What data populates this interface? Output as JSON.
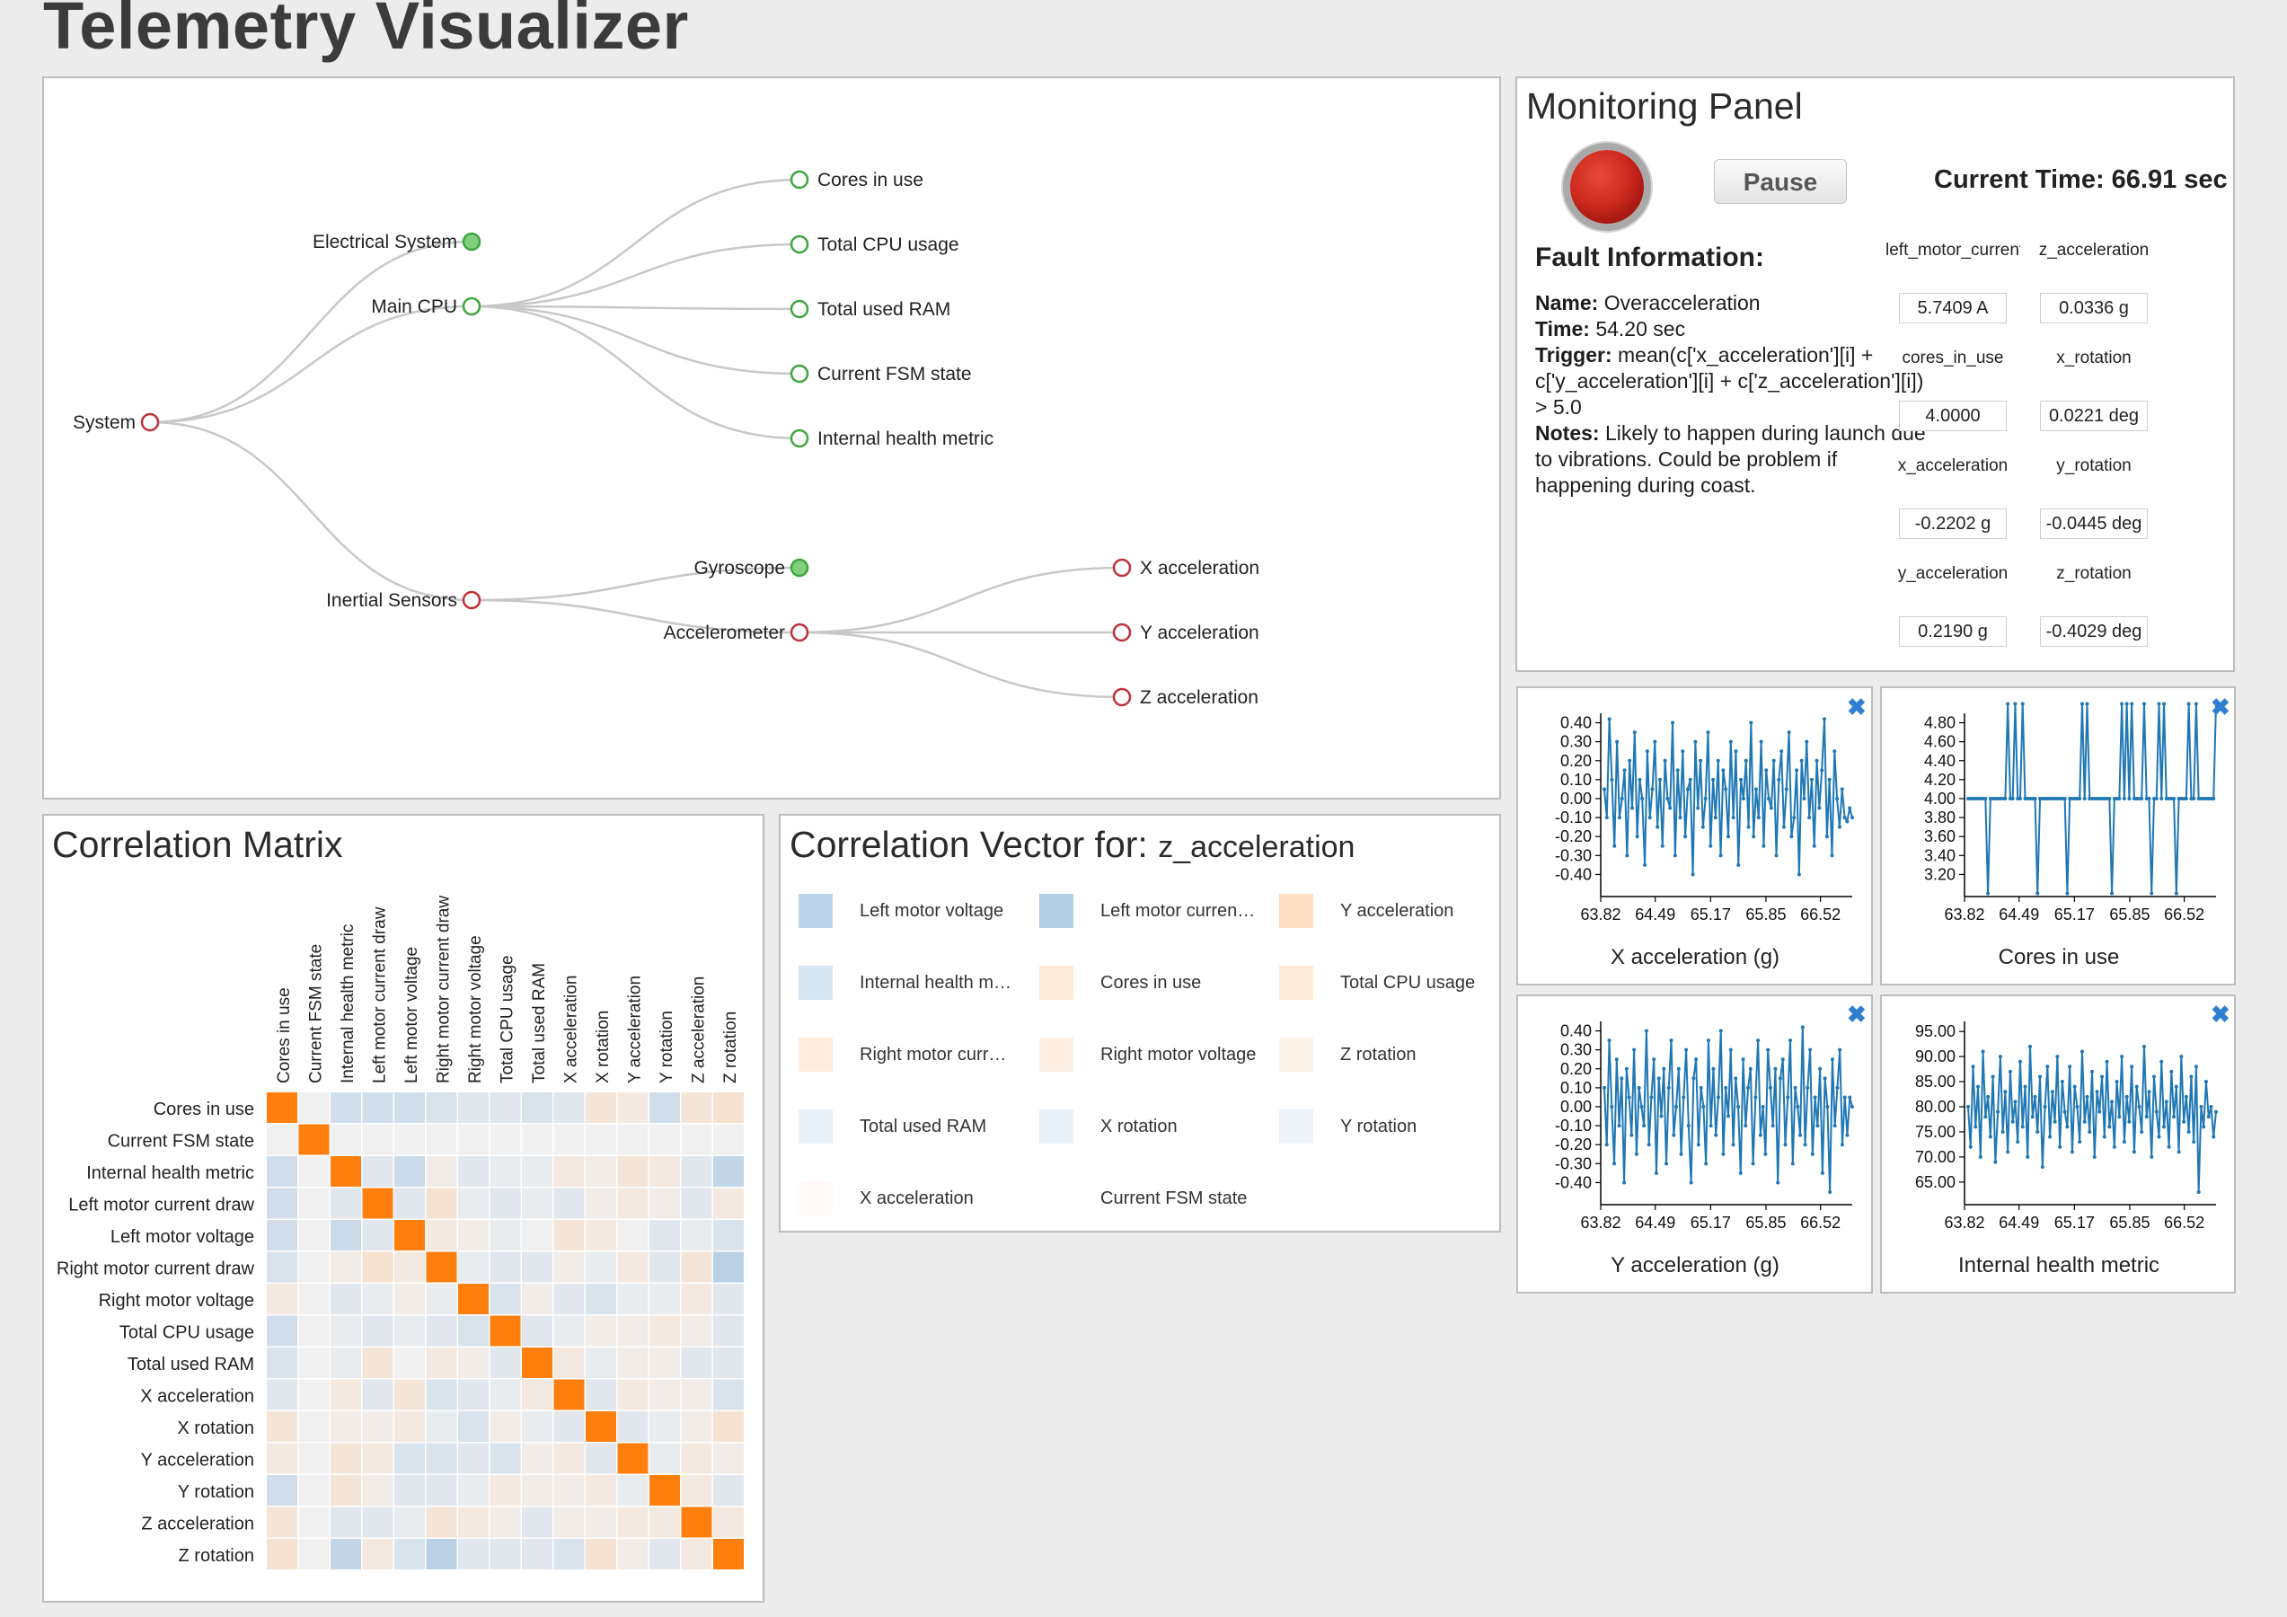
{
  "app": {
    "title": "Telemetry Visualizer"
  },
  "tree": {
    "nodes": [
      {
        "id": "system",
        "label": "System",
        "filled": false,
        "color": "#c0303a"
      },
      {
        "id": "electrical",
        "label": "Electrical System",
        "filled": true,
        "color": "#3fa53f"
      },
      {
        "id": "main_cpu",
        "label": "Main CPU",
        "filled": false,
        "color": "#3fa53f"
      },
      {
        "id": "inertial",
        "label": "Inertial Sensors",
        "filled": false,
        "color": "#c0303a"
      },
      {
        "id": "cores",
        "label": "Cores in use",
        "filled": false,
        "color": "#3fa53f"
      },
      {
        "id": "cpu_usage",
        "label": "Total CPU usage",
        "filled": false,
        "color": "#3fa53f"
      },
      {
        "id": "ram",
        "label": "Total used RAM",
        "filled": false,
        "color": "#3fa53f"
      },
      {
        "id": "fsm",
        "label": "Current FSM state",
        "filled": false,
        "color": "#3fa53f"
      },
      {
        "id": "health",
        "label": "Internal health metric",
        "filled": false,
        "color": "#3fa53f"
      },
      {
        "id": "gyro",
        "label": "Gyroscope",
        "filled": true,
        "color": "#3fa53f"
      },
      {
        "id": "accel",
        "label": "Accelerometer",
        "filled": false,
        "color": "#c0303a"
      },
      {
        "id": "xacc",
        "label": "X acceleration",
        "filled": false,
        "color": "#c0303a"
      },
      {
        "id": "yacc",
        "label": "Y acceleration",
        "filled": false,
        "color": "#c0303a"
      },
      {
        "id": "zacc",
        "label": "Z acceleration",
        "filled": false,
        "color": "#c0303a"
      }
    ],
    "edges": [
      [
        "system",
        "electrical"
      ],
      [
        "system",
        "main_cpu"
      ],
      [
        "system",
        "inertial"
      ],
      [
        "main_cpu",
        "cores"
      ],
      [
        "main_cpu",
        "cpu_usage"
      ],
      [
        "main_cpu",
        "ram"
      ],
      [
        "main_cpu",
        "fsm"
      ],
      [
        "main_cpu",
        "health"
      ],
      [
        "inertial",
        "gyro"
      ],
      [
        "inertial",
        "accel"
      ],
      [
        "accel",
        "xacc"
      ],
      [
        "accel",
        "yacc"
      ],
      [
        "accel",
        "zacc"
      ]
    ]
  },
  "monitoring": {
    "title": "Monitoring Panel",
    "pause_label": "Pause",
    "current_time_label": "Current Time: 66.91 sec",
    "fault_heading": "Fault Information:",
    "fault": {
      "name_label": "Name:",
      "name": "Overacceleration",
      "time_label": "Time:",
      "time": "54.20 sec",
      "trigger_label": "Trigger:",
      "trigger": "mean(c['x_acceleration'][i] + c['y_acceleration'][i] + c['z_acceleration'][i]) > 5.0",
      "notes_label": "Notes:",
      "notes": "Likely to happen during launch due to vibrations. Could be problem if happening during coast."
    },
    "values": [
      {
        "name": "left_motor_current",
        "value": "5.7409 A"
      },
      {
        "name": "z_acceleration",
        "value": "0.0336 g"
      },
      {
        "name": "cores_in_use",
        "value": "4.0000"
      },
      {
        "name": "x_rotation",
        "value": "0.0221 deg"
      },
      {
        "name": "x_acceleration",
        "value": "-0.2202 g"
      },
      {
        "name": "y_rotation",
        "value": "-0.0445 deg"
      },
      {
        "name": "y_acceleration",
        "value": "0.2190 g"
      },
      {
        "name": "z_rotation",
        "value": "-0.4029 deg"
      }
    ]
  },
  "correlation_matrix": {
    "title": "Correlation Matrix",
    "labels": [
      "Cores in use",
      "Current FSM state",
      "Internal health metric",
      "Left motor current draw",
      "Left motor voltage",
      "Right motor current draw",
      "Right motor voltage",
      "Total CPU usage",
      "Total used RAM",
      "X acceleration",
      "X rotation",
      "Y acceleration",
      "Y rotation",
      "Z acceleration",
      "Z rotation"
    ],
    "colors": {
      "positive": "#ff7f0e",
      "negative": "#1f77b4",
      "neutral": "#f0f0f0"
    },
    "values": [
      [
        1,
        0,
        -0.2,
        -0.2,
        -0.2,
        -0.15,
        -0.1,
        -0.1,
        -0.15,
        -0.1,
        0.15,
        0.1,
        -0.2,
        0.15,
        0.2
      ],
      [
        0,
        1,
        0,
        0,
        0,
        0,
        0,
        0,
        0,
        0,
        0,
        0,
        0,
        0,
        0
      ],
      [
        -0.2,
        0,
        1,
        -0.1,
        -0.25,
        0.05,
        -0.1,
        -0.05,
        -0.05,
        0.1,
        0.05,
        0.15,
        0.1,
        -0.1,
        -0.3
      ],
      [
        -0.2,
        0,
        -0.1,
        1,
        -0.1,
        0.2,
        -0.05,
        -0.1,
        -0.05,
        -0.1,
        0.05,
        0.1,
        0.05,
        -0.1,
        0.1
      ],
      [
        -0.2,
        0,
        -0.25,
        -0.1,
        1,
        0.1,
        0.05,
        -0.05,
        0,
        0.15,
        0.1,
        0,
        -0.1,
        -0.05,
        -0.15
      ],
      [
        -0.15,
        0,
        0.05,
        0.2,
        0.1,
        1,
        -0.05,
        -0.1,
        -0.1,
        0.05,
        -0.05,
        0.1,
        -0.1,
        0.15,
        -0.35
      ],
      [
        0.1,
        0,
        -0.1,
        -0.05,
        0.05,
        -0.05,
        1,
        -0.15,
        0.05,
        -0.1,
        -0.15,
        -0.05,
        -0.05,
        0.1,
        -0.1
      ],
      [
        -0.2,
        0,
        -0.05,
        -0.1,
        -0.05,
        -0.1,
        -0.15,
        1,
        -0.1,
        -0.05,
        0.05,
        0.05,
        0.1,
        0.05,
        -0.1
      ],
      [
        -0.15,
        0,
        -0.05,
        0.15,
        0,
        0.1,
        0.05,
        -0.1,
        1,
        0.1,
        -0.05,
        0.05,
        0.05,
        -0.1,
        -0.1
      ],
      [
        -0.1,
        0,
        0.1,
        -0.1,
        0.15,
        -0.15,
        -0.1,
        -0.05,
        0.1,
        1,
        -0.1,
        0.1,
        0.05,
        0.05,
        -0.15
      ],
      [
        0.15,
        0,
        0.05,
        0.05,
        0.1,
        -0.05,
        -0.15,
        0.05,
        -0.05,
        -0.1,
        1,
        -0.1,
        -0.05,
        0.05,
        0.2
      ],
      [
        0.1,
        0,
        0.15,
        0.1,
        -0.15,
        -0.15,
        -0.1,
        -0.15,
        0.05,
        0.1,
        -0.1,
        1,
        -0.05,
        0.1,
        0.05
      ],
      [
        -0.2,
        0,
        0.15,
        0.05,
        -0.1,
        -0.1,
        -0.05,
        0.1,
        0.05,
        0.05,
        0.1,
        -0.05,
        1,
        0.1,
        -0.1
      ],
      [
        0.15,
        0,
        -0.1,
        -0.1,
        -0.05,
        0.15,
        0.1,
        0.05,
        -0.1,
        0.05,
        0.05,
        0.1,
        0.1,
        1,
        0.1
      ],
      [
        0.2,
        0,
        -0.3,
        0.1,
        -0.15,
        -0.35,
        -0.1,
        -0.1,
        -0.1,
        -0.15,
        0.2,
        0.05,
        -0.1,
        0.1,
        1
      ]
    ]
  },
  "correlation_vector": {
    "title_prefix": "Correlation Vector for:",
    "variable": "z_acceleration",
    "items": [
      {
        "label": "Left motor voltage",
        "value": -0.25
      },
      {
        "label": "Left motor curren…",
        "value": -0.28
      },
      {
        "label": "Y acceleration",
        "value": 0.22
      },
      {
        "label": "Internal health m…",
        "value": -0.15
      },
      {
        "label": "Cores in use",
        "value": 0.14
      },
      {
        "label": "Total CPU usage",
        "value": 0.14
      },
      {
        "label": "Right motor curr…",
        "value": 0.12
      },
      {
        "label": "Right motor voltage",
        "value": 0.1
      },
      {
        "label": "Z rotation",
        "value": 0.08
      },
      {
        "label": "Total used RAM",
        "value": -0.08
      },
      {
        "label": "X rotation",
        "value": -0.08
      },
      {
        "label": "Y rotation",
        "value": -0.07
      },
      {
        "label": "X acceleration",
        "value": 0.03
      },
      {
        "label": "Current FSM state",
        "value": 0
      }
    ]
  },
  "chart_data": [
    {
      "type": "line",
      "title": "X acceleration (g)",
      "color": "#1f77b4",
      "xlim": [
        63.82,
        66.91
      ],
      "ylim": [
        -0.45,
        0.45
      ],
      "xticks": [
        "63.82",
        "64.49",
        "65.17",
        "65.85",
        "66.52"
      ],
      "yticks": [
        "0.40",
        "0.30",
        "0.20",
        "0.10",
        "0.00",
        "-0.10",
        "-0.20",
        "-0.30",
        "-0.40"
      ],
      "values": [
        0.05,
        -0.1,
        0.42,
        0.1,
        -0.25,
        0.3,
        -0.1,
        0.0,
        0.15,
        -0.3,
        0.2,
        -0.05,
        0.35,
        -0.2,
        0.1,
        0.0,
        -0.35,
        0.25,
        -0.1,
        0.05,
        0.3,
        -0.15,
        0.1,
        -0.25,
        0.2,
        0.0,
        -0.05,
        0.4,
        -0.3,
        0.15,
        -0.1,
        0.25,
        -0.2,
        0.05,
        0.1,
        -0.4,
        0.3,
        -0.05,
        0.2,
        -0.15,
        0.0,
        0.35,
        -0.25,
        0.1,
        -0.1,
        0.2,
        -0.3,
        0.15,
        0.05,
        -0.2,
        0.3,
        -0.1,
        0.25,
        -0.35,
        0.1,
        0.0,
        0.2,
        -0.15,
        0.4,
        -0.2,
        0.05,
        -0.1,
        0.3,
        -0.25,
        0.15,
        0.0,
        -0.05,
        0.2,
        -0.3,
        0.1,
        0.25,
        -0.15,
        0.05,
        0.35,
        -0.2,
        -0.1,
        0.15,
        -0.4,
        0.2,
        0.0,
        0.3,
        -0.1,
        0.1,
        -0.25,
        0.2,
        -0.05,
        0.15,
        0.42,
        -0.2,
        0.1,
        -0.3,
        0.25,
        0.0,
        -0.15,
        0.05,
        -0.1,
        -0.12,
        -0.05,
        -0.1
      ]
    },
    {
      "type": "line",
      "title": "Cores in use",
      "color": "#1f77b4",
      "xlim": [
        63.82,
        66.91
      ],
      "ylim": [
        3.1,
        4.9
      ],
      "xticks": [
        "63.82",
        "64.49",
        "65.17",
        "65.85",
        "66.52"
      ],
      "yticks": [
        "4.80",
        "4.60",
        "4.40",
        "4.20",
        "4.00",
        "3.80",
        "3.60",
        "3.40",
        "3.20"
      ],
      "values": [
        4,
        4,
        4,
        4,
        4,
        4,
        4,
        4,
        3,
        4,
        4,
        4,
        4,
        4,
        4,
        4,
        5,
        4,
        4,
        5,
        4,
        4,
        5,
        4,
        4,
        4,
        4,
        4,
        3,
        4,
        4,
        4,
        4,
        4,
        4,
        4,
        4,
        4,
        4,
        4,
        3,
        4,
        4,
        4,
        4,
        4,
        5,
        4,
        5,
        4,
        4,
        4,
        4,
        4,
        4,
        4,
        4,
        4,
        3,
        4,
        4,
        4,
        5,
        4,
        5,
        4,
        5,
        4,
        4,
        4,
        4,
        5,
        4,
        4,
        3,
        4,
        4,
        5,
        4,
        5,
        4,
        4,
        4,
        4,
        3,
        4,
        4,
        4,
        4,
        5,
        4,
        4,
        5,
        4,
        4,
        4,
        4,
        4,
        4,
        4,
        5
      ]
    },
    {
      "type": "line",
      "title": "Y acceleration (g)",
      "color": "#1f77b4",
      "xlim": [
        63.82,
        66.91
      ],
      "ylim": [
        -0.45,
        0.45
      ],
      "xticks": [
        "63.82",
        "64.49",
        "65.17",
        "65.85",
        "66.52"
      ],
      "yticks": [
        "0.40",
        "0.30",
        "0.20",
        "0.10",
        "0.00",
        "-0.10",
        "-0.20",
        "-0.30",
        "-0.40"
      ],
      "values": [
        0.1,
        -0.2,
        0.35,
        0.0,
        -0.3,
        0.25,
        -0.1,
        0.15,
        -0.4,
        0.2,
        0.05,
        -0.15,
        0.3,
        -0.25,
        0.1,
        0.0,
        -0.1,
        0.4,
        -0.2,
        0.05,
        0.25,
        -0.35,
        0.15,
        -0.05,
        0.2,
        -0.3,
        0.1,
        0.35,
        -0.15,
        0.0,
        0.2,
        -0.25,
        0.05,
        0.3,
        -0.1,
        -0.4,
        0.15,
        0.25,
        -0.2,
        0.1,
        0.0,
        -0.3,
        0.35,
        -0.1,
        0.2,
        -0.15,
        0.05,
        0.4,
        -0.25,
        0.1,
        -0.05,
        0.3,
        -0.2,
        0.15,
        0.0,
        -0.35,
        0.25,
        -0.1,
        0.1,
        0.2,
        -0.3,
        0.05,
        0.35,
        -0.15,
        0.0,
        -0.25,
        0.3,
        0.1,
        -0.1,
        0.2,
        -0.4,
        0.15,
        0.25,
        -0.2,
        0.05,
        0.35,
        -0.3,
        0.1,
        0.0,
        -0.15,
        0.42,
        -0.2,
        0.1,
        0.3,
        -0.25,
        0.05,
        -0.1,
        0.2,
        -0.35,
        0.15,
        0.0,
        -0.45,
        0.25,
        -0.1,
        0.1,
        0.3,
        -0.2,
        0.05,
        -0.15,
        0.05,
        0.0
      ]
    },
    {
      "type": "line",
      "title": "Internal health metric",
      "color": "#1f77b4",
      "xlim": [
        63.82,
        66.91
      ],
      "ylim": [
        63,
        97
      ],
      "xticks": [
        "63.82",
        "64.49",
        "65.17",
        "65.85",
        "66.52"
      ],
      "yticks": [
        "95.00",
        "90.00",
        "85.00",
        "80.00",
        "75.00",
        "70.00",
        "65.00"
      ],
      "values": [
        80,
        72,
        88,
        76,
        84,
        70,
        91,
        78,
        82,
        74,
        86,
        69,
        79,
        90,
        75,
        83,
        71,
        87,
        77,
        81,
        73,
        89,
        76,
        84,
        70,
        92,
        78,
        82,
        75,
        86,
        68,
        80,
        88,
        74,
        83,
        77,
        90,
        72,
        85,
        79,
        76,
        88,
        71,
        84,
        80,
        73,
        91,
        77,
        82,
        75,
        87,
        70,
        83,
        79,
        86,
        74,
        89,
        76,
        81,
        72,
        85,
        78,
        90,
        73,
        82,
        77,
        88,
        71,
        84,
        80,
        75,
        92,
        78,
        83,
        70,
        86,
        79,
        74,
        89,
        76,
        81,
        72,
        87,
        78,
        84,
        71,
        90,
        77,
        82,
        75,
        86,
        73,
        88,
        63,
        80,
        76,
        85,
        78,
        80,
        74,
        79
      ]
    }
  ]
}
